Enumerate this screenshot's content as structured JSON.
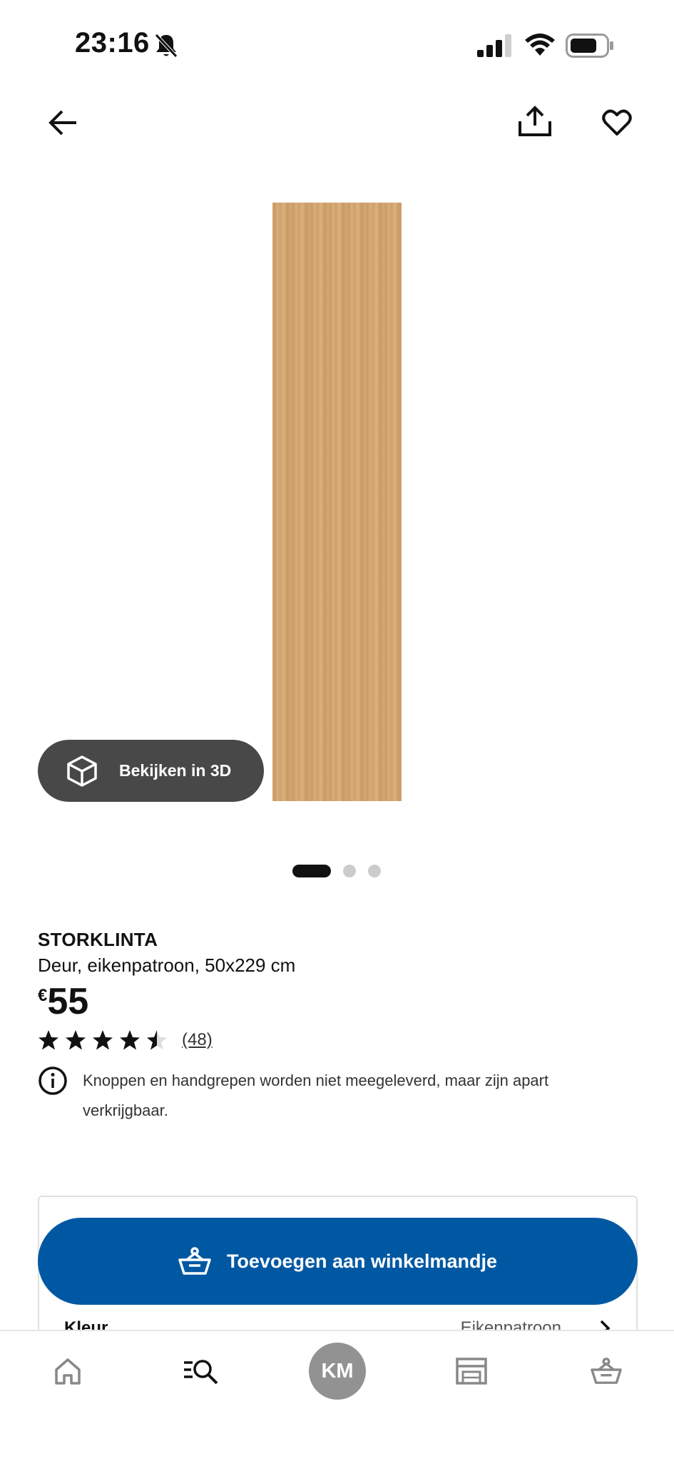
{
  "status": {
    "time": "23:16"
  },
  "product": {
    "brand": "STORKLINTA",
    "description": "Deur, eikenpatroon, 50x229 cm",
    "currency": "€",
    "price": "55",
    "rating": 4.5,
    "review_count": "(48)",
    "info": "Knoppen en handgrepen worden niet meegeleverd, maar zijn apart verkrijgbaar.",
    "view_3d_label": "Bekijken in 3D",
    "image_count": 3,
    "active_image": 1
  },
  "options": {
    "color_label": "Kleur",
    "color_value": "Eikenpatroon"
  },
  "cart_button": {
    "label": "Toevoegen aan winkelmandje"
  },
  "tabbar": {
    "profile_initials": "KM"
  },
  "colors": {
    "primary_blue": "#0058a3",
    "view3d_bg": "#484848"
  }
}
